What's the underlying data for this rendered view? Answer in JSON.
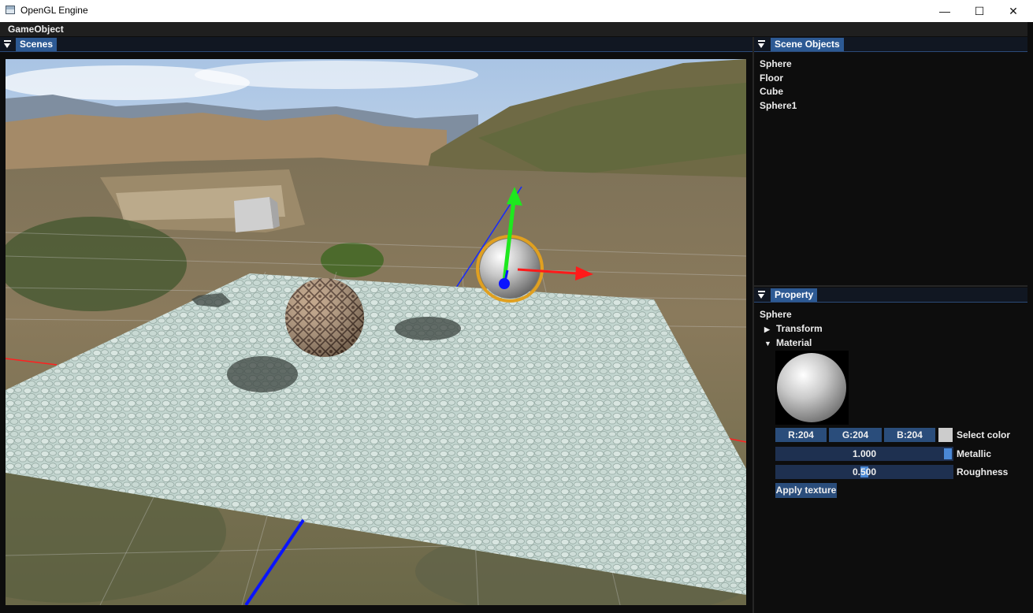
{
  "window": {
    "title": "OpenGL Engine",
    "controls": [
      "—",
      "☐",
      "✕"
    ]
  },
  "menu": {
    "items": [
      "GameObject"
    ]
  },
  "scenes_panel": {
    "tab_label": "Scenes"
  },
  "scene_objects": {
    "tab_label": "Scene Objects",
    "items": [
      "Sphere",
      "Floor",
      "Cube",
      "Sphere1"
    ]
  },
  "property": {
    "tab_label": "Property",
    "object_name": "Sphere",
    "transform_label": "Transform",
    "material_label": "Material",
    "color": {
      "r": "R:204",
      "g": "G:204",
      "b": "B:204",
      "swatch": "#cccccc",
      "select_label": "Select color"
    },
    "metallic": {
      "value": "1.000",
      "fraction": 1.0,
      "label": "Metallic"
    },
    "roughness": {
      "value": "0.500",
      "fraction": 0.5,
      "label": "Roughness"
    },
    "apply_texture_label": "Apply texture"
  },
  "colors": {
    "accent": "#2d5a94",
    "gizmo_y": "#1ee81e",
    "gizmo_x": "#ff1a1a",
    "gizmo_z": "#0a14ff",
    "selection": "#e0a020"
  }
}
